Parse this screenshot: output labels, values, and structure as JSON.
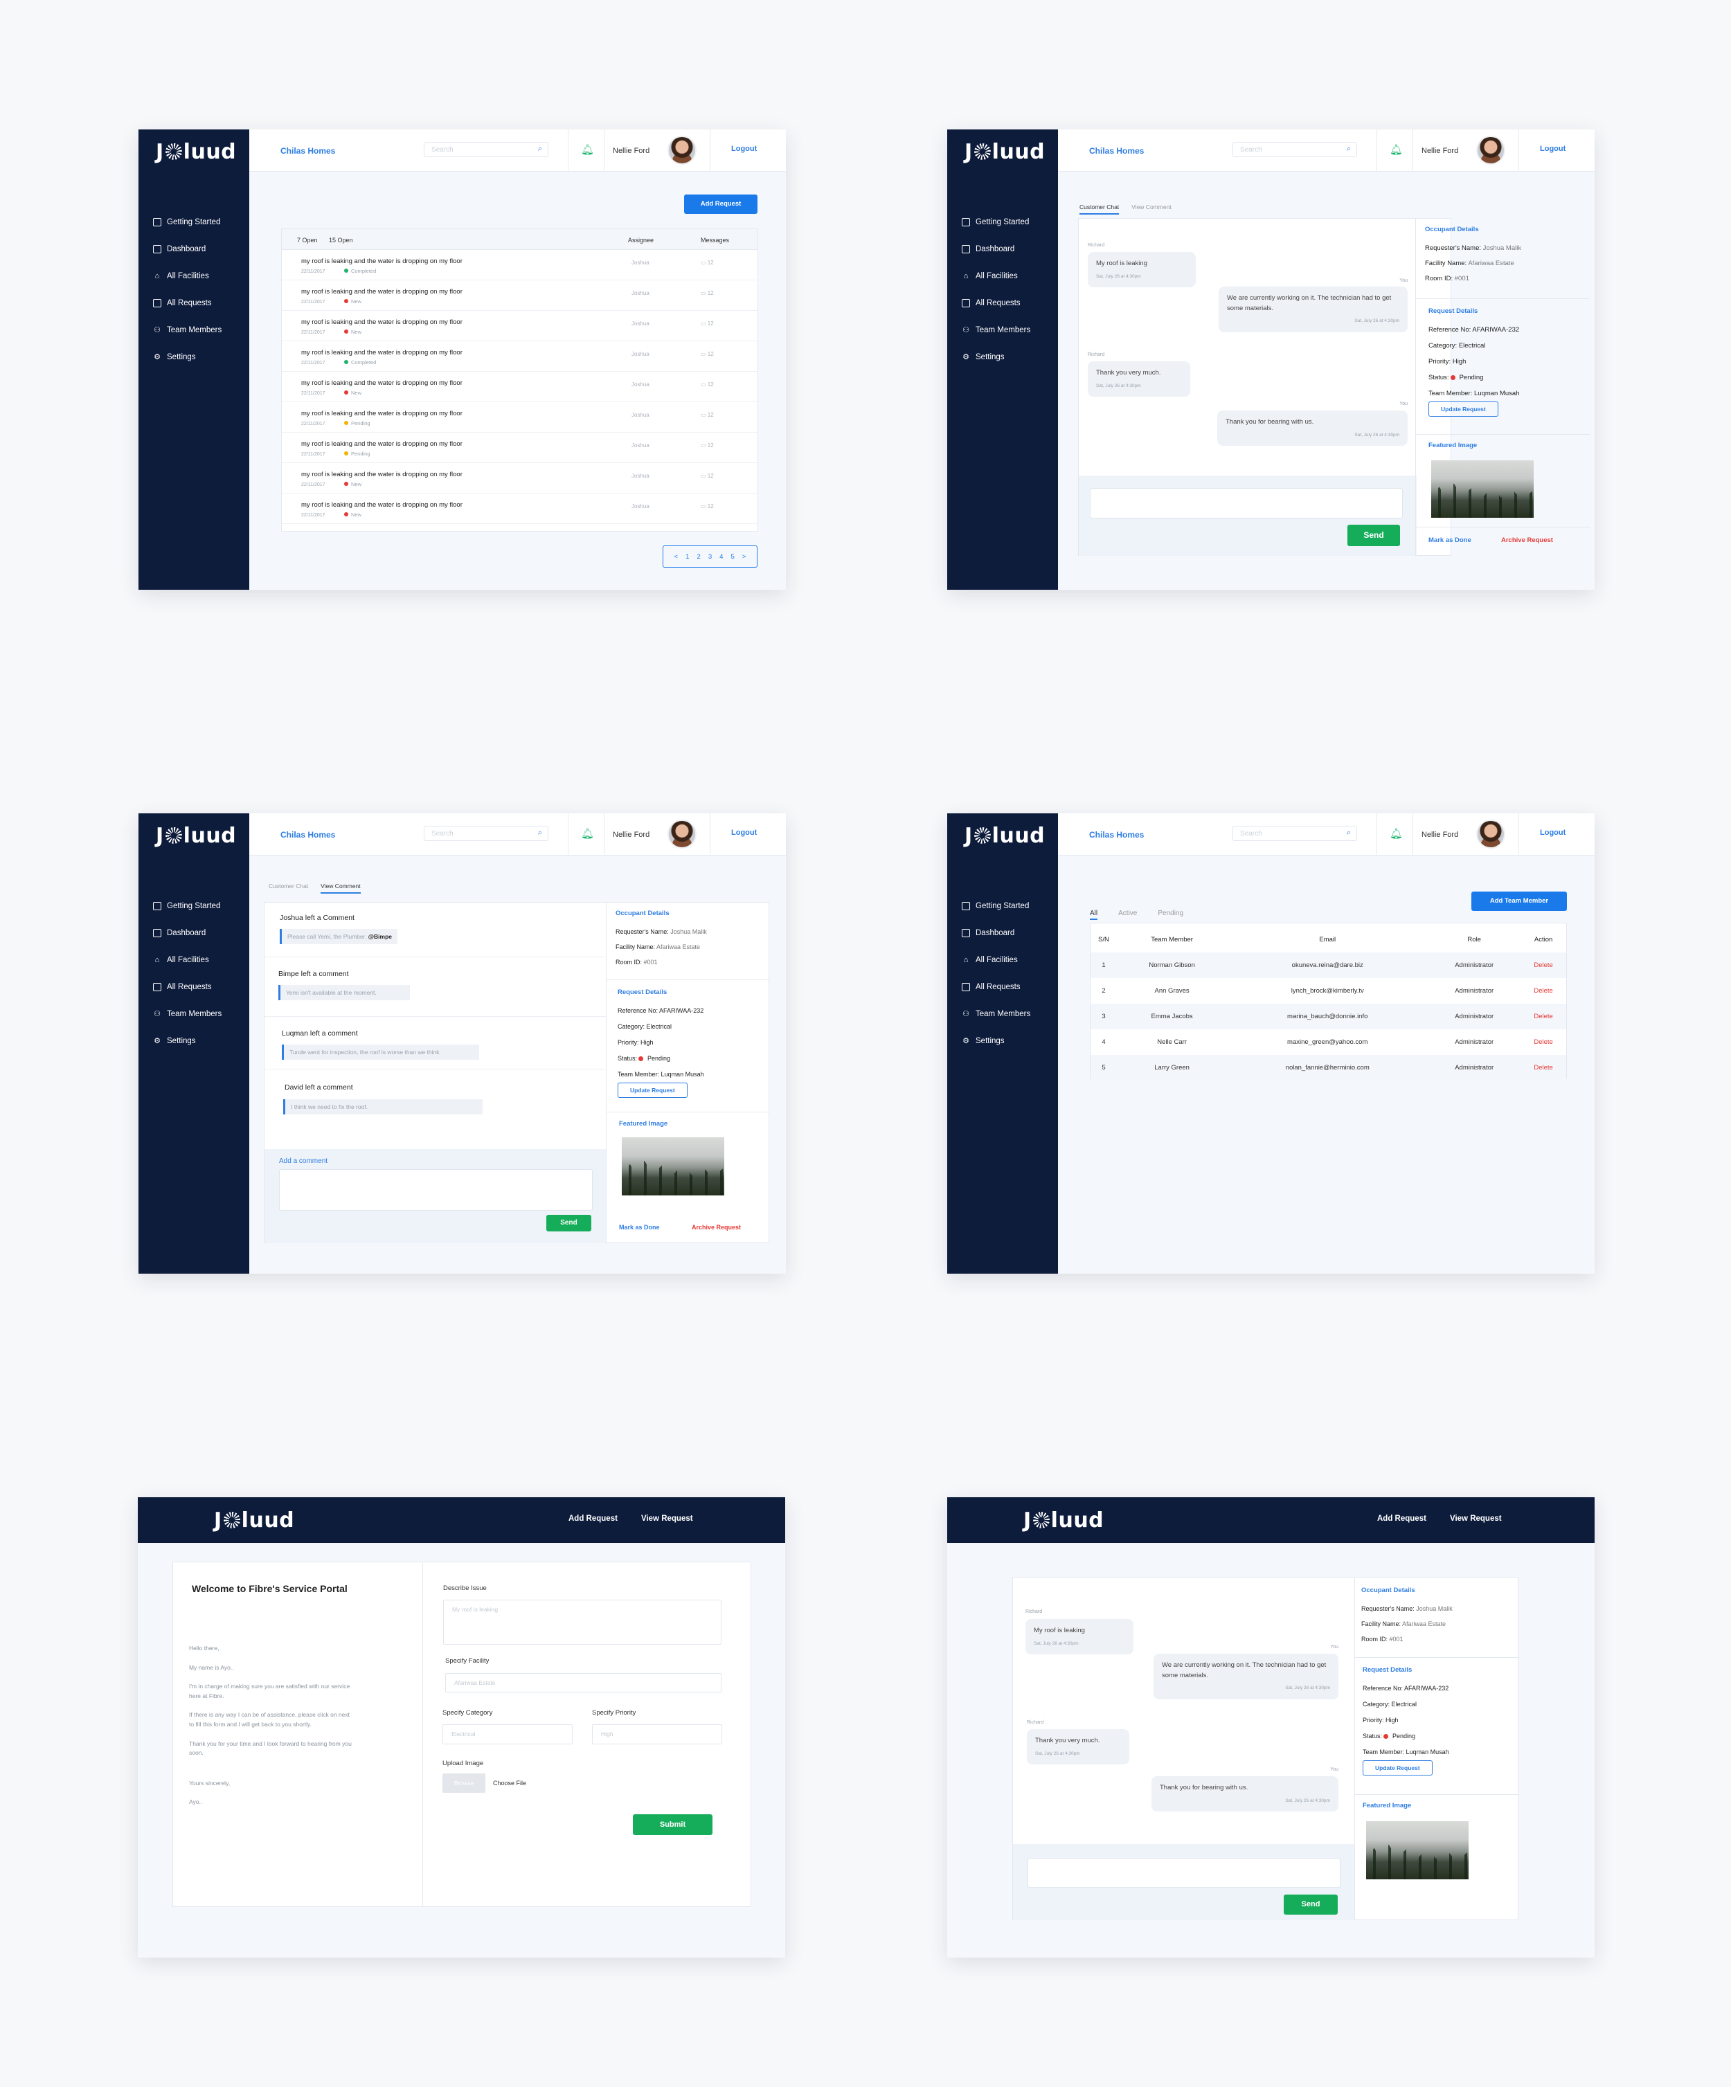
{
  "brand": {
    "logo_left": "J",
    "logo_right": "luud"
  },
  "nav": [
    "Getting Started",
    "Dashboard",
    "All Facilities",
    "All Requests",
    "Team Members",
    "Settings"
  ],
  "header": {
    "org": "Chilas Homes",
    "search_placeholder": "Search",
    "user": "Nellie Ford",
    "logout": "Logout"
  },
  "requests": {
    "add_button": "Add Request",
    "tab_open": "7 Open",
    "tab_closed": "15 Open",
    "col_assignee": "Assignee",
    "col_messages": "Messages",
    "rows": [
      {
        "title": "my roof is leaking and the water is dropping on my floor",
        "date": "22/11/2017",
        "status": "Completed",
        "color": "#1fb26b",
        "assignee": "Joshua",
        "messages": "12"
      },
      {
        "title": "my roof is leaking and the water is dropping on my floor",
        "date": "22/11/2017",
        "status": "New",
        "color": "#e53935",
        "assignee": "Joshua",
        "messages": "12"
      },
      {
        "title": "my roof is leaking and the water is dropping on my floor",
        "date": "22/11/2017",
        "status": "New",
        "color": "#e53935",
        "assignee": "Joshua",
        "messages": "12"
      },
      {
        "title": "my roof is leaking and the water is dropping on my floor",
        "date": "22/11/2017",
        "status": "Completed",
        "color": "#1fb26b",
        "assignee": "Joshua",
        "messages": "12"
      },
      {
        "title": "my roof is leaking and the water is dropping on my floor",
        "date": "22/11/2017",
        "status": "New",
        "color": "#e53935",
        "assignee": "Joshua",
        "messages": "12"
      },
      {
        "title": "my roof is leaking and the water is dropping on my floor",
        "date": "22/11/2017",
        "status": "Pending",
        "color": "#f3b400",
        "assignee": "Joshua",
        "messages": "12"
      },
      {
        "title": "my roof is leaking and the water is dropping on my floor",
        "date": "22/11/2017",
        "status": "Pending",
        "color": "#f3b400",
        "assignee": "Joshua",
        "messages": "12"
      },
      {
        "title": "my roof is leaking and the water is dropping on my floor",
        "date": "22/11/2017",
        "status": "New",
        "color": "#e53935",
        "assignee": "Joshua",
        "messages": "12"
      },
      {
        "title": "my roof is leaking and the water is dropping on my floor",
        "date": "22/11/2017",
        "status": "New",
        "color": "#e53935",
        "assignee": "Joshua",
        "messages": "12"
      }
    ],
    "pager": [
      "<",
      "1",
      "2",
      "3",
      "4",
      "5",
      ">"
    ]
  },
  "chat": {
    "tab_chat": "Customer Chat",
    "tab_comment": "View Comment",
    "msgs": [
      {
        "who": "Richard",
        "text": "My roof is leaking",
        "time": "Sat, July 26 at 4:30pm"
      },
      {
        "who": "You",
        "text": "We are currently working on it. The technician had to get some materials.",
        "time": "Sat, July 26 at 4:30pm"
      },
      {
        "who": "Richard",
        "text": "Thank you very much.",
        "time": "Sat, July 26 at 4:30pm"
      },
      {
        "who": "You",
        "text": "Thank you for bearing with us.",
        "time": "Sat, July 26 at 4:30pm"
      }
    ],
    "send": "Send"
  },
  "details": {
    "occ_title": "Occupant Details",
    "req_name_l": "Requester's Name:",
    "req_name": "Joshua Malik",
    "fac_l": "Facility Name:",
    "fac": "Afariwaa Estate",
    "room_l": "Room ID:",
    "room": "#001",
    "req_title": "Request Details",
    "ref_l": "Reference No:",
    "ref": "AFARIWAA-232",
    "cat_l": "Category:",
    "cat": "Electrical",
    "pri_l": "Priority:",
    "pri": "High",
    "status_l": "Status:",
    "status": "Pending",
    "team_l": "Team Member:",
    "team": "Luqman Musah",
    "update": "Update Request",
    "img_title": "Featured Image",
    "done": "Mark as Done",
    "archive": "Archive Request"
  },
  "comments": {
    "items": [
      {
        "head": "Joshua left a Comment",
        "text": "Please call Yemi, the Plumber.",
        "mention": "@Bimpe"
      },
      {
        "head": "Bimpe left a comment",
        "text": "Yemi isn't available at the moment.",
        "mention": ""
      },
      {
        "head": "Luqman left a comment",
        "text": "Tunde went for inspection, the roof is worse than we think",
        "mention": ""
      },
      {
        "head": "David left a comment",
        "text": "I think we need to fix the roof.",
        "mention": ""
      }
    ],
    "add_label": "Add a comment",
    "send": "Send"
  },
  "team": {
    "tabs": [
      "All",
      "Active",
      "Pending"
    ],
    "add": "Add Team Member",
    "cols": [
      "S/N",
      "Team Member",
      "Email",
      "Role",
      "Action"
    ],
    "rows": [
      [
        "1",
        "Norman Gibson",
        "okuneva.reina@dare.biz",
        "Administrator",
        "Delete"
      ],
      [
        "2",
        "Ann Graves",
        "lynch_brock@kimberly.tv",
        "Administrator",
        "Delete"
      ],
      [
        "3",
        "Emma Jacobs",
        "marina_bauch@donnie.info",
        "Administrator",
        "Delete"
      ],
      [
        "4",
        "Nelle Carr",
        "maxine_green@yahoo.com",
        "Administrator",
        "Delete"
      ],
      [
        "5",
        "Larry Green",
        "nolan_fannie@herminio.com",
        "Administrator",
        "Delete"
      ]
    ]
  },
  "portal": {
    "nav_add": "Add Request",
    "nav_view": "View Request",
    "welcome": "Welcome to Fibre's Service Portal",
    "letter": [
      "Hello there,",
      "My name is Ayo..",
      "I'm in charge of making sure you are satisfied with our service here at Fibre.",
      "If there is any way I can be of assistance, please click on next to fill this form and I will get back to you shortly.",
      "Thank you for your time and I look forward to hearing from you soon.",
      "Yours sincerely,",
      "Ayo.."
    ],
    "describe_l": "Describe Issue",
    "describe_ph": "My roof is leaking",
    "facility_l": "Specify Facility",
    "facility_ph": "Afariwaa Estate",
    "category_l": "Specify Category",
    "category_ph": "Electrical",
    "priority_l": "Specify Priority",
    "priority_ph": "High",
    "upload_l": "Upload Image",
    "browse": "Browse",
    "choose": "Choose File",
    "submit": "Submit"
  }
}
